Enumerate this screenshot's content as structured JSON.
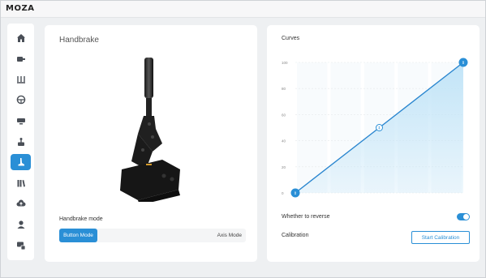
{
  "app": {
    "title": "MOZA"
  },
  "sidebar": {
    "items": [
      {
        "icon": "home-icon",
        "active": false
      },
      {
        "icon": "wheelbase-icon",
        "active": false
      },
      {
        "icon": "pedals-icon",
        "active": false
      },
      {
        "icon": "steering-wheel-icon",
        "active": false
      },
      {
        "icon": "dashboard-icon",
        "active": false
      },
      {
        "icon": "shifter-icon",
        "active": false
      },
      {
        "icon": "handbrake-icon",
        "active": true
      },
      {
        "icon": "library-icon",
        "active": false
      },
      {
        "icon": "cloud-upload-icon",
        "active": false
      },
      {
        "icon": "user-icon",
        "active": false
      },
      {
        "icon": "devices-icon",
        "active": false
      }
    ]
  },
  "handbrake_panel": {
    "title": "Handbrake",
    "mode_label": "Handbrake mode",
    "modes": {
      "selected": "Button Mode",
      "other": "Axis Mode"
    }
  },
  "curves_panel": {
    "title": "Curves",
    "reverse_label": "Whether to reverse",
    "reverse_enabled": true,
    "calibration_label": "Calibration",
    "calibration_button": "Start Calibration"
  },
  "chart_data": {
    "type": "line",
    "x": [
      0,
      50,
      100
    ],
    "y": [
      0,
      50,
      100
    ],
    "tick_labels": [
      "100",
      "80",
      "60",
      "40",
      "20",
      "0"
    ],
    "ylim": [
      0,
      100
    ],
    "grid": true,
    "colors": {
      "line": "#2a86cf",
      "fill": "#bfe3f7",
      "point": "#2a8fd6"
    }
  },
  "colors": {
    "accent": "#2a8fd6"
  }
}
